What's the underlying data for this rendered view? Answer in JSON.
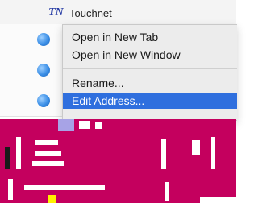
{
  "window": {
    "title": "Touchnet"
  },
  "bookmark": {
    "logo_text": "TN",
    "title": "Touchnet",
    "icon": "globe-icon"
  },
  "context_menu": {
    "items": [
      {
        "label": "Open in New Tab",
        "selected": false
      },
      {
        "label": "Open in New Window",
        "selected": false
      },
      {
        "label": "Rename...",
        "selected": false
      },
      {
        "label": "Edit Address...",
        "selected": true
      }
    ],
    "selection_color": "#2f6fde"
  },
  "colors": {
    "glitch": "#c4005e"
  }
}
